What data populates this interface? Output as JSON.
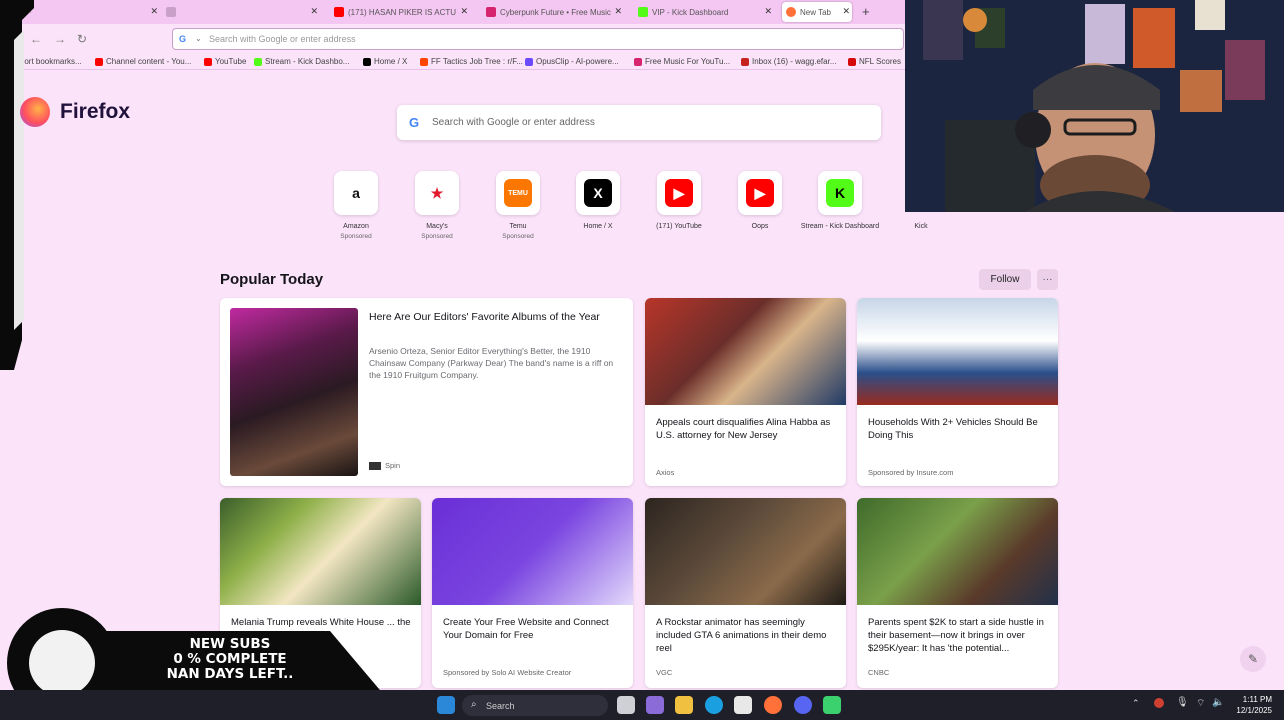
{
  "browser": {
    "tabs": [
      {
        "label": "(171) HASAN PIKER IS ACTU",
        "color": "#ff0000"
      },
      {
        "label": "Cyberpunk Future • Free Music",
        "color": "#d6246f"
      },
      {
        "label": "VIP - Kick Dashboard",
        "color": "#53fc18"
      },
      {
        "label": "New Tab",
        "color": "#ff7139"
      }
    ],
    "url_placeholder": "Search with Google or enter address",
    "bookmarks": [
      {
        "label": "Import bookmarks...",
        "color": "#aaaaaa"
      },
      {
        "label": "Channel content - You...",
        "color": "#ff0000"
      },
      {
        "label": "YouTube",
        "color": "#ff0000"
      },
      {
        "label": "Stream - Kick Dashbo...",
        "color": "#53fc18"
      },
      {
        "label": "Home / X",
        "color": "#000000"
      },
      {
        "label": "FF Tactics Job Tree : r/F...",
        "color": "#ff4500"
      },
      {
        "label": "OpusClip - AI-powere...",
        "color": "#6b4bff"
      },
      {
        "label": "Free Music For YouTu...",
        "color": "#d6246f"
      },
      {
        "label": "Inbox (16) - wagg.efar...",
        "color": "#c5221f"
      },
      {
        "label": "NFL Scores",
        "color": "#d50a0a"
      }
    ]
  },
  "newtab": {
    "brand": "Firefox",
    "search_placeholder": "Search with Google or enter address",
    "top_sites": [
      {
        "label": "Amazon",
        "sponsored": "Sponsored",
        "icon": "amazon-icon",
        "bg": "#ffffff",
        "fg": "#111111",
        "glyph": "a"
      },
      {
        "label": "Macy's",
        "sponsored": "Sponsored",
        "icon": "macys-star-icon",
        "bg": "#ffffff",
        "fg": "#e21a2c",
        "glyph": "★"
      },
      {
        "label": "Temu",
        "sponsored": "Sponsored",
        "icon": "temu-icon",
        "bg": "#fb7701",
        "fg": "#ffffff",
        "glyph": "TEMU"
      },
      {
        "label": "Home / X",
        "sponsored": "",
        "icon": "x-icon",
        "bg": "#000000",
        "fg": "#ffffff",
        "glyph": "X"
      },
      {
        "label": "(171) YouTube",
        "sponsored": "",
        "icon": "youtube-icon",
        "bg": "#ff0000",
        "fg": "#ffffff",
        "glyph": "▶"
      },
      {
        "label": "Oops",
        "sponsored": "",
        "icon": "youtube-icon",
        "bg": "#ff0000",
        "fg": "#ffffff",
        "glyph": "▶"
      },
      {
        "label": "Stream - Kick Dashboard",
        "sponsored": "",
        "icon": "kick-icon",
        "bg": "#53fc18",
        "fg": "#000000",
        "glyph": "K"
      },
      {
        "label": "Kick",
        "sponsored": "",
        "icon": "kick-icon",
        "bg": "#53fc18",
        "fg": "#000000",
        "glyph": "K"
      }
    ],
    "popular_title": "Popular Today",
    "follow_label": "Follow",
    "more_label": "···",
    "feature": {
      "title": "Here Are Our Editors' Favorite Albums of the Year",
      "excerpt": "Arsenio Orteza, Senior Editor Everything's Better, the 1910 Chainsaw Company (Parkway Dear) The band's name is a riff on the 1910 Fruitgum Company.",
      "source": "Spin"
    },
    "cards": [
      {
        "title": "Appeals court disqualifies Alina Habba as U.S. attorney for New Jersey",
        "source": "Axios",
        "img": "linear-gradient(135deg,#b8352a 0%,#6b2e2a 40%,#d9b48a 60%,#203a66 100%)"
      },
      {
        "title": "Households With 2+ Vehicles Should Be Doing This",
        "source": "Sponsored by Insure.com",
        "img": "linear-gradient(180deg,#c7d6e8 0%,#ffffff 40%,#2a4f8a 70%,#9a2a1e 100%)"
      },
      {
        "title": "Melania Trump reveals White House ... the theme, ... Is'",
        "source": "",
        "img": "linear-gradient(135deg,#3a5e2a 0%,#8fb04a 30%,#f2e6c2 55%,#2b5a2a 100%)"
      },
      {
        "title": "Create Your Free Website and Connect Your Domain for Free",
        "source": "Sponsored by Solo AI Website Creator",
        "img": "linear-gradient(135deg,#6a2fd6 0%,#7a45e0 50%,#e3d9fb 100%)"
      },
      {
        "title": "A Rockstar animator has seemingly included GTA 6 animations in their demo reel",
        "source": "VGC",
        "img": "linear-gradient(135deg,#2d2520 0%,#5c4a3a 40%,#8a6a4a 70%,#1e1a16 100%)"
      },
      {
        "title": "Parents spent $2K to start a side hustle in their basement—now it brings in over $295K/year: It has 'the potential...",
        "source": "CNBC",
        "img": "linear-gradient(135deg,#3f6a2a 0%,#7aa04a 40%,#5a3a2a 70%,#22304a 100%)"
      }
    ]
  },
  "overlay": {
    "line1": "NEW SUBS",
    "line2": "0 % COMPLETE",
    "line3": "NAN DAYS LEFT.."
  },
  "taskbar": {
    "search_label": "Search",
    "time": "1:11 PM",
    "date": "12/1/2025"
  }
}
